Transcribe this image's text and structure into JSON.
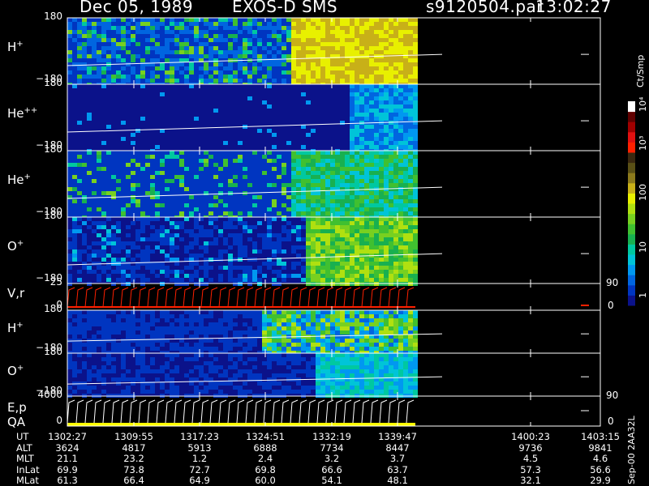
{
  "header": {
    "date": "Dec 05, 1989",
    "mission": "EXOS-D SMS",
    "file": "s9120504.par",
    "time": "13:02:27"
  },
  "colorbar": {
    "unit": "Ct/Smp",
    "ticks": [
      "1",
      "10",
      "100",
      "10³",
      "10⁴"
    ],
    "colors": [
      "#0b128a",
      "#0035c0",
      "#0065e0",
      "#0098f0",
      "#00c4d8",
      "#00c8a0",
      "#18b050",
      "#40c030",
      "#78d020",
      "#b0e010",
      "#e8f000",
      "#c8b018",
      "#8c7a1c",
      "#5a5016",
      "#3a2810",
      "#ff2000",
      "#e01010",
      "#a00000",
      "#600000",
      "#ffffff"
    ]
  },
  "chart_data": {
    "type": "heatmap",
    "title": "Dec 05, 1989   EXOS-D SMS",
    "time_axis": {
      "label": "UT",
      "ticks": [
        "1302:27",
        "1309:55",
        "1317:23",
        "1324:51",
        "1332:19",
        "1339:47",
        "1400:23",
        "1403:15"
      ]
    },
    "panels": [
      {
        "name": "H+",
        "label_base": "H",
        "label_sup": "+",
        "ylim": [
          -180,
          180
        ],
        "tick_top": "180",
        "tick_bottom": "−180",
        "scale": "pitch-angle"
      },
      {
        "name": "He++",
        "label_base": "He",
        "label_sup": "++",
        "ylim": [
          -180,
          180
        ],
        "tick_top": "180",
        "tick_bottom": "−180",
        "scale": "pitch-angle"
      },
      {
        "name": "He+",
        "label_base": "He",
        "label_sup": "+",
        "ylim": [
          -180,
          180
        ],
        "tick_top": "180",
        "tick_bottom": "−180",
        "scale": "pitch-angle"
      },
      {
        "name": "O+",
        "label_base": "O",
        "label_sup": "+",
        "ylim": [
          -180,
          180
        ],
        "tick_top": "180",
        "tick_bottom": "−180",
        "scale": "pitch-angle"
      },
      {
        "name": "V,r",
        "label_base": "V,r",
        "label_sup": "",
        "ylim": [
          0,
          25
        ],
        "tick_top": "25",
        "tick_bottom": "0",
        "right_top": "90",
        "right_bottom": "0",
        "scale": "line"
      },
      {
        "name": "H+ (2)",
        "label_base": "H",
        "label_sup": "+",
        "ylim": [
          -180,
          180
        ],
        "tick_top": "180",
        "tick_bottom": "−180",
        "scale": "pitch-angle"
      },
      {
        "name": "O+ (2)",
        "label_base": "O",
        "label_sup": "+",
        "ylim": [
          -180,
          180
        ],
        "tick_top": "180",
        "tick_bottom": "−180",
        "scale": "pitch-angle"
      },
      {
        "name": "E,p QA",
        "label_base": "E,p",
        "label2": "QA",
        "ylim": [
          0,
          4000
        ],
        "tick_top": "4000",
        "tick_bottom": "0",
        "right_top": "90",
        "right_bottom": "0",
        "scale": "line"
      }
    ],
    "ephemeris": {
      "rows": [
        {
          "label": "UT",
          "values": [
            "1302:27",
            "1309:55",
            "1317:23",
            "1324:51",
            "1332:19",
            "1339:47",
            "1400:23",
            "1403:15"
          ]
        },
        {
          "label": "ALT",
          "values": [
            "3624",
            "4817",
            "5913",
            "6888",
            "7734",
            "8447",
            "9736",
            "9841"
          ]
        },
        {
          "label": "MLT",
          "values": [
            "21.1",
            "23.2",
            "1.2",
            "2.4",
            "3.2",
            "3.7",
            "4.5",
            "4.6"
          ]
        },
        {
          "label": "InLat",
          "values": [
            "69.9",
            "73.8",
            "72.7",
            "69.8",
            "66.6",
            "63.7",
            "57.3",
            "56.6"
          ]
        },
        {
          "label": "MLat",
          "values": [
            "61.3",
            "66.4",
            "64.9",
            "60.0",
            "54.1",
            "48.1",
            "32.1",
            "29.9"
          ]
        }
      ]
    },
    "footnote": "Sep-00 2AA32L"
  }
}
